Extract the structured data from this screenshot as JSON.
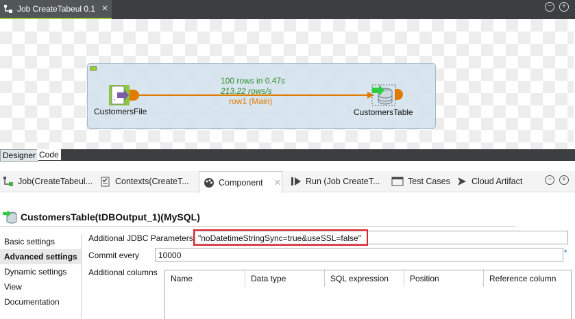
{
  "editor": {
    "tab_title": "Job CreateTabeul 0.1",
    "close_glyph": "✕"
  },
  "canvas": {
    "source_component": "CustomersFile",
    "target_component": "CustomersTable",
    "flow": {
      "rows_text": "100 rows in 0.47s",
      "rate_text": "213.22 rows/s",
      "link_label": "row1 (Main)"
    },
    "colors": {
      "link": "#e07b00",
      "stats": "#2e8b2e",
      "subjob_bg": "#d2e2ec"
    }
  },
  "view_tabs": [
    {
      "label": "Designer",
      "active": true
    },
    {
      "label": "Code",
      "active": false
    }
  ],
  "bottom_tabs": [
    {
      "label": "Job(CreateTabeul...",
      "icon": "job-icon"
    },
    {
      "label": "Contexts(CreateT...",
      "icon": "contexts-icon"
    },
    {
      "label": "Component",
      "icon": "palette-icon",
      "active": true
    },
    {
      "label": "Run (Job CreateT...",
      "icon": "run-icon"
    },
    {
      "label": "Test Cases",
      "icon": "test-cases-icon"
    },
    {
      "label": "Cloud Artifact",
      "icon": "cloud-artifact-icon"
    }
  ],
  "component_panel": {
    "title": "CustomersTable(tDBOutput_1)(MySQL)",
    "nav": [
      {
        "label": "Basic settings",
        "active": false
      },
      {
        "label": "Advanced settings",
        "active": true
      },
      {
        "label": "Dynamic settings",
        "active": false
      },
      {
        "label": "View",
        "active": false
      },
      {
        "label": "Documentation",
        "active": false
      }
    ],
    "jdbc_label": "Additional JDBC Parameters",
    "jdbc_value": "\"noDatetimeStringSync=true&useSSL=false\"",
    "commit_label": "Commit every",
    "commit_value": "10000",
    "commit_marker": "*",
    "columns_label": "Additional columns",
    "columns_headers": [
      "Name",
      "Data type",
      "SQL expression",
      "Position",
      "Reference column"
    ]
  }
}
